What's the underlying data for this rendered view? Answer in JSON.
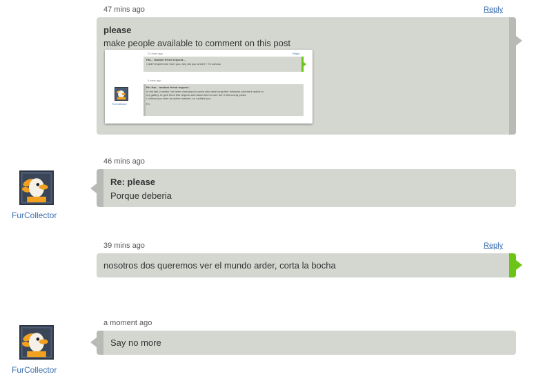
{
  "colors": {
    "bubble": "#d4d6d0",
    "bar_gray": "#b8bab5",
    "bar_green": "#6cc417",
    "link": "#3a6fb0"
  },
  "comments": [
    {
      "timestamp": "47 mins ago",
      "reply_label": "Reply",
      "title": "please",
      "body": "make people available to comment on this post",
      "screenshot": {
        "c1_timestamp": "22 mins ago",
        "c1_reply": "Reply",
        "c1_title": "Hm... random friend request...",
        "c1_body": "I didn't expect one from you, why did you send it? I'm curious",
        "c2_timestamp": "4 mins ago",
        "c2_user": "FurCollector",
        "c2_title": "Re: Hm... random friend request...",
        "c2_body_1": "In the last 2 weeks I've been checking for users who were long time followers and were active in",
        "c2_body_2": "my gallery, to give them this request and allow them to see the 3 friend-only posts.",
        "c2_body_3": "I noticed you were an active watcher, so I added you.",
        "c2_sign": "FC"
      }
    },
    {
      "timestamp": "46 mins ago",
      "username": "FurCollector",
      "title": "Re: please",
      "body": "Porque deberia"
    },
    {
      "timestamp": "39 mins ago",
      "reply_label": "Reply",
      "body": "nosotros dos queremos ver el mundo arder, corta la bocha"
    },
    {
      "timestamp": "a moment ago",
      "username": "FurCollector",
      "body": "Say no more"
    }
  ]
}
